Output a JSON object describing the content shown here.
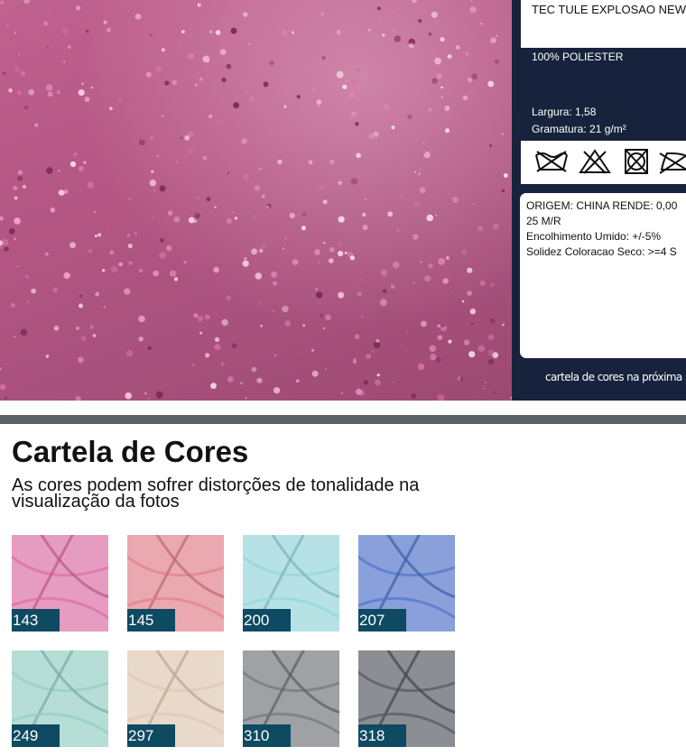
{
  "product": {
    "name": "TEC TULE EXPLOSAO NEW",
    "composition": "100% POLIESTER",
    "width": "Largura: 1,58",
    "weight": "Gramatura: 21 g/m²",
    "care_icons": [
      "do-not-wash-icon",
      "do-not-bleach-icon",
      "do-not-tumble-dry-icon",
      "do-not-iron-icon"
    ],
    "details": [
      "ORIGEM: CHINA RENDE: 0,00",
      "25 M/R",
      "Encolhimento Umido: +/-5%",
      "Solidez Coloracao Seco: >=4 S"
    ],
    "footer_note": "cartela de cores na próxima pa"
  },
  "palette": {
    "title": "Cartela de Cores",
    "subtitle": "As cores podem sofrer distorções de tonalidade na visualização da fotos",
    "swatches": [
      {
        "code": "143",
        "color": "#d9669f"
      },
      {
        "code": "145",
        "color": "#de7a86"
      },
      {
        "code": "200",
        "color": "#8fd3d8"
      },
      {
        "code": "207",
        "color": "#4a6dc6"
      },
      {
        "code": "249",
        "color": "#8fcac0"
      },
      {
        "code": "297",
        "color": "#dcc4ad"
      },
      {
        "code": "310",
        "color": "#6c6f74"
      },
      {
        "code": "318",
        "color": "#4d5158"
      }
    ]
  },
  "colors": {
    "panel": "#17233d",
    "code_badge": "#0e4a62",
    "fabric": "#b45683"
  }
}
